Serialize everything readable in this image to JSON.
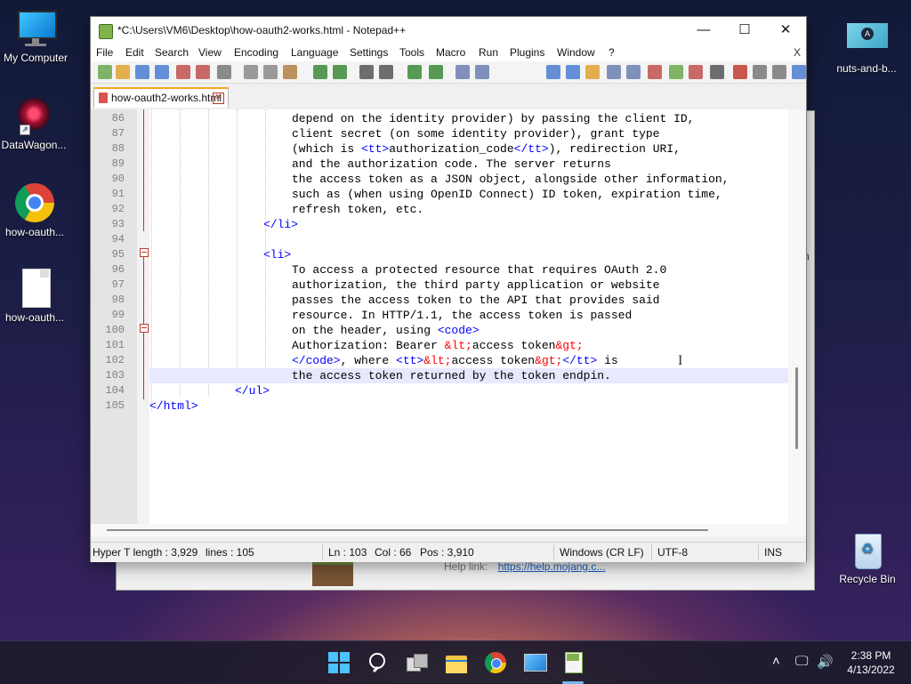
{
  "desktop": {
    "icons": [
      {
        "label": "My Computer"
      },
      {
        "label": "DataWagon..."
      },
      {
        "label": "how-oauth..."
      },
      {
        "label": "how-oauth..."
      },
      {
        "label": "nuts-and-b..."
      },
      {
        "label": "Recycle Bin"
      }
    ]
  },
  "background_window": {
    "help_label": "Help link:",
    "help_link": "https://help.mojang.c...",
    "edge_char": "n"
  },
  "window": {
    "title": "*C:\\Users\\VM6\\Desktop\\how-oauth2-works.html - Notepad++",
    "controls": {
      "minimize": "—",
      "maximize": "☐",
      "close": "✕"
    }
  },
  "menu": {
    "items": [
      "File",
      "Edit",
      "Search",
      "View",
      "Encoding",
      "Language",
      "Settings",
      "Tools",
      "Macro",
      "Run",
      "Plugins",
      "Window",
      "?"
    ],
    "close_doc": "X"
  },
  "toolbar": {
    "buttons": [
      "new-file-icon",
      "open-file-icon",
      "save-icon",
      "save-all-icon",
      "close-file-icon",
      "close-all-icon",
      "print-icon",
      "cut-icon",
      "copy-icon",
      "paste-icon",
      "undo-icon",
      "redo-icon",
      "find-icon",
      "replace-icon",
      "zoom-in-icon",
      "zoom-out-icon",
      "sync-vertical-icon",
      "sync-horizontal-icon",
      "word-wrap-icon",
      "show-all-chars-icon",
      "indent-guide-icon",
      "doc-map-icon",
      "function-list-icon",
      "folder-workspace-icon",
      "monitoring-icon",
      "user-lang-icon",
      "eye-icon",
      "record-macro-icon",
      "stop-macro-icon",
      "play-macro-icon",
      "run-macro-multiple-icon",
      "save-macro-icon"
    ]
  },
  "tab": {
    "label": "how-oauth2-works.html",
    "close": "✕"
  },
  "editor": {
    "lines": [
      {
        "num": "86",
        "segs": [
          {
            "t": "depend on the identity provider) by passing the client ID,",
            "c": ""
          }
        ]
      },
      {
        "num": "87",
        "segs": [
          {
            "t": "client secret (on some identity provider), grant type",
            "c": ""
          }
        ]
      },
      {
        "num": "88",
        "segs": [
          {
            "t": "(which is ",
            "c": ""
          },
          {
            "t": "<tt>",
            "c": "tag"
          },
          {
            "t": "authorization_code",
            "c": ""
          },
          {
            "t": "</tt>",
            "c": "tag"
          },
          {
            "t": "), redirection URI,",
            "c": ""
          }
        ]
      },
      {
        "num": "89",
        "segs": [
          {
            "t": "and the authorization code. The server returns",
            "c": ""
          }
        ]
      },
      {
        "num": "90",
        "segs": [
          {
            "t": "the access token as a JSON object, alongside other information,",
            "c": ""
          }
        ]
      },
      {
        "num": "91",
        "segs": [
          {
            "t": "such as (when using OpenID Connect) ID token, expiration time,",
            "c": ""
          }
        ]
      },
      {
        "num": "92",
        "segs": [
          {
            "t": "refresh token, etc.",
            "c": ""
          }
        ]
      },
      {
        "num": "93",
        "segs": [
          {
            "t": "</li>",
            "c": "tag"
          }
        ]
      },
      {
        "num": "94",
        "segs": []
      },
      {
        "num": "95",
        "segs": [
          {
            "t": "<li>",
            "c": "tag"
          }
        ]
      },
      {
        "num": "96",
        "segs": [
          {
            "t": "To access a protected resource that requires OAuth 2.0",
            "c": ""
          }
        ]
      },
      {
        "num": "97",
        "segs": [
          {
            "t": "authorization, the third party application or website",
            "c": ""
          }
        ]
      },
      {
        "num": "98",
        "segs": [
          {
            "t": "passes the access token to the API that provides said",
            "c": ""
          }
        ]
      },
      {
        "num": "99",
        "segs": [
          {
            "t": "resource. In HTTP/1.1, the access token is passed",
            "c": ""
          }
        ]
      },
      {
        "num": "100",
        "segs": [
          {
            "t": "on the header, using ",
            "c": ""
          },
          {
            "t": "<code>",
            "c": "tag"
          }
        ]
      },
      {
        "num": "101",
        "segs": [
          {
            "t": "Authorization: Bearer ",
            "c": ""
          },
          {
            "t": "&lt;",
            "c": "ent"
          },
          {
            "t": "access token",
            "c": ""
          },
          {
            "t": "&gt;",
            "c": "ent"
          }
        ]
      },
      {
        "num": "102",
        "segs": [
          {
            "t": "</code>",
            "c": "tag"
          },
          {
            "t": ", where ",
            "c": ""
          },
          {
            "t": "<tt>",
            "c": "tag"
          },
          {
            "t": "&lt;",
            "c": "ent"
          },
          {
            "t": "access token",
            "c": ""
          },
          {
            "t": "&gt;",
            "c": "ent"
          },
          {
            "t": "</tt>",
            "c": "tag"
          },
          {
            "t": " is",
            "c": ""
          }
        ]
      },
      {
        "num": "103",
        "segs": [
          {
            "t": "the access token returned by the token endpin.",
            "c": ""
          }
        ]
      },
      {
        "num": "104",
        "segs": [
          {
            "t": "</ul>",
            "c": "tag"
          }
        ]
      },
      {
        "num": "105",
        "segs": [
          {
            "t": "</html>",
            "c": "tag"
          }
        ]
      }
    ]
  },
  "status": {
    "type": "Hyper T length : 3,929",
    "lines": "lines : 105",
    "ln": "Ln : 103",
    "col": "Col : 66",
    "pos": "Pos : 3,910",
    "eol": "Windows (CR LF)",
    "encoding": "UTF-8",
    "mode": "INS"
  },
  "clock": {
    "time": "2:38 PM",
    "date": "4/13/2022"
  },
  "colors": {
    "tag": "#0000ff",
    "entity": "#ff0000",
    "current_line": "#e8e8ff"
  }
}
